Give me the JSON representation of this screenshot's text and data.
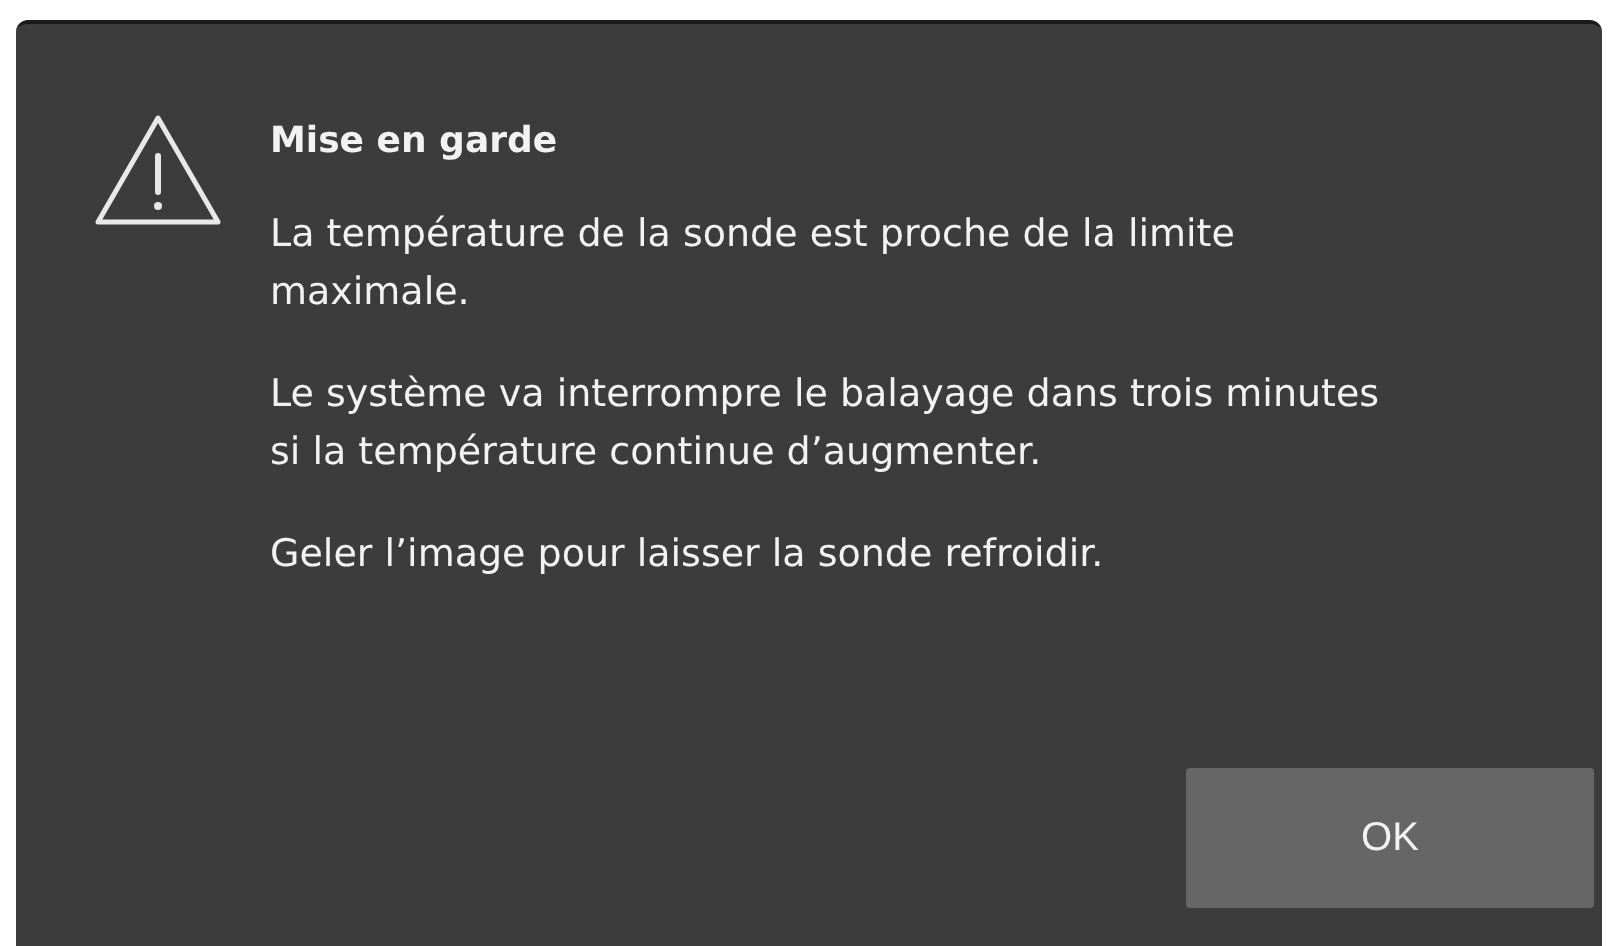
{
  "dialog": {
    "title": "Mise en garde",
    "paragraphs": [
      "La température de la sonde est proche de la limite maximale.",
      "Le système va interrompre le balayage dans trois minutes si la température continue d’augmenter.",
      "Geler l’image pour laisser la sonde refroidir."
    ],
    "buttons": [
      "OK"
    ]
  }
}
